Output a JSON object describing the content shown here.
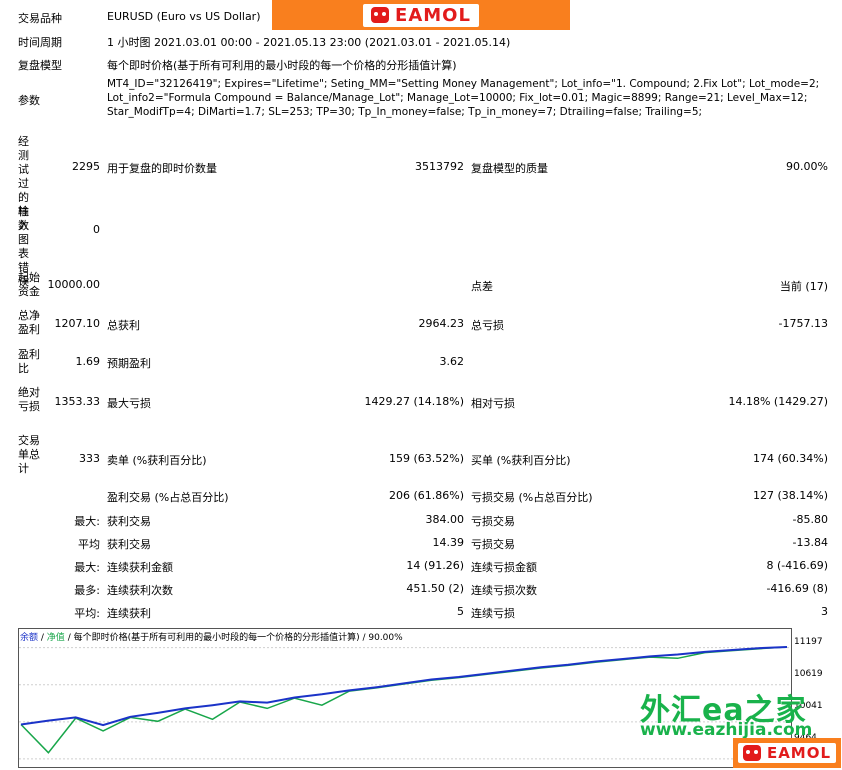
{
  "header": {
    "logo_text": "EAMOL",
    "symbol_label": "交易品种",
    "symbol_value": "EURUSD (Euro vs US Dollar)",
    "period_label": "时间周期",
    "period_value": "1 小时图 2021.03.01 00:00 - 2021.05.13 23:00 (2021.03.01 - 2021.05.14)",
    "model_label": "复盘模型",
    "model_value": "每个即时价格(基于所有可利用的最小时段的每一个价格的分形插值计算)",
    "params_label": "参数",
    "params_value": "MT4_ID=\"32126419\"; Expires=\"Lifetime\"; Seting_MM=\"Setting Money Management\"; Lot_info=\"1. Compound; 2.Fix Lot\"; Lot_mode=2; Lot_info2=\"Formula Compound = Balance/Manage_Lot\"; Manage_Lot=10000; Fix_lot=0.01; Magic=8899; Range=21; Level_Max=12; Star_ModifTp=4; DiMarti=1.7; SL=253; TP=30; Tp_In_money=false; Tp_in_money=7; Dtrailing=false; Trailing=5;"
  },
  "stats": {
    "bars_label": "经测试过的柱数",
    "bars_value": "2295",
    "ticks_label": "用于复盘的即时价数量",
    "ticks_value": "3513792",
    "quality_label": "复盘模型的质量",
    "quality_value": "90.00%",
    "errors_label": "输入图表错误",
    "errors_value": "0",
    "deposit_label": "起始资金",
    "deposit_value": "10000.00",
    "spread_label": "点差",
    "spread_value": "当前 (17)",
    "net_label": "总净盈利",
    "net_value": "1207.10",
    "gross_profit_label": "总获利",
    "gross_profit_value": "2964.23",
    "gross_loss_label": "总亏损",
    "gross_loss_value": "-1757.13",
    "pf_label": "盈利比",
    "pf_value": "1.69",
    "expected_label": "预期盈利",
    "expected_value": "3.62",
    "abs_dd_label": "绝对亏损",
    "abs_dd_value": "1353.33",
    "max_dd_label": "最大亏损",
    "max_dd_value": "1429.27 (14.18%)",
    "rel_dd_label": "相对亏损",
    "rel_dd_value": "14.18% (1429.27)",
    "trades_label": "交易单总计",
    "trades_value": "333",
    "short_label": "卖单 (%获利百分比)",
    "short_value": "159 (63.52%)",
    "long_label": "买单 (%获利百分比)",
    "long_value": "174 (60.34%)",
    "profit_trades_label": "盈利交易 (%占总百分比)",
    "profit_trades_value": "206 (61.86%)",
    "loss_trades_label": "亏损交易 (%占总百分比)",
    "loss_trades_value": "127 (38.14%)",
    "largest_label": "最大:",
    "largest_profit_label": "获利交易",
    "largest_profit_value": "384.00",
    "largest_loss_label": "亏损交易",
    "largest_loss_value": "-85.80",
    "average_label": "平均",
    "average_profit_label": "获利交易",
    "average_profit_value": "14.39",
    "average_loss_label": "亏损交易",
    "average_loss_value": "-13.84",
    "max_label": "最大:",
    "max_cons_wins_label": "连续获利金额",
    "max_cons_wins_value": "14 (91.26)",
    "max_cons_losses_label": "连续亏损金额",
    "max_cons_losses_value": "8 (-416.69)",
    "maximal_label": "最多:",
    "maximal_cons_profit_label": "连续获利次数",
    "maximal_cons_profit_value": "451.50 (2)",
    "maximal_cons_loss_label": "连续亏损次数",
    "maximal_cons_loss_value": "-416.69 (8)",
    "avg_cons_label": "平均:",
    "avg_cons_wins_label": "连续获利",
    "avg_cons_wins_value": "5",
    "avg_cons_losses_label": "连续亏损",
    "avg_cons_losses_value": "3"
  },
  "chart": {
    "caption_balance": "余额",
    "caption_equity": "净值",
    "caption_rest": "每个即时价格(基于所有可利用的最小时段的每一个价格的分形插值计算) / 90.00%",
    "y_labels": [
      "11197",
      "10619",
      "10041",
      "9464"
    ],
    "balance_color": "#1b33c8",
    "equity_color": "#18a64a"
  },
  "chart_data": {
    "type": "line",
    "y_ticks": [
      11197,
      10619,
      10041,
      9464
    ],
    "ylim": [
      9400,
      11300
    ],
    "series": [
      {
        "name": "余额",
        "values": [
          10000,
          10060,
          10110,
          9990,
          10120,
          10180,
          10250,
          10300,
          10360,
          10340,
          10420,
          10470,
          10530,
          10580,
          10640,
          10700,
          10740,
          10790,
          10840,
          10890,
          10930,
          10980,
          11020,
          11060,
          11090,
          11130,
          11160,
          11190,
          11207
        ]
      },
      {
        "name": "净值",
        "values": [
          10000,
          9560,
          10100,
          9900,
          10110,
          10050,
          10240,
          10080,
          10350,
          10250,
          10410,
          10300,
          10520,
          10570,
          10630,
          10690,
          10730,
          10780,
          10830,
          10880,
          10920,
          10970,
          11010,
          11050,
          11030,
          11120,
          11150,
          11180,
          11207
        ]
      }
    ]
  },
  "watermark": {
    "zh": "外汇ea之家",
    "url": "www.eazhijia.com"
  }
}
